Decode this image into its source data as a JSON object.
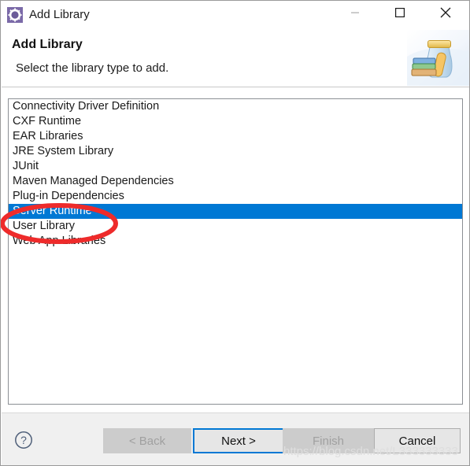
{
  "window": {
    "title": "Add Library",
    "icon": "library-wizard-icon",
    "controls": {
      "minimize": "minimize-icon",
      "maximize": "maximize-icon",
      "close": "close-icon"
    }
  },
  "header": {
    "title": "Add Library",
    "subtitle": "Select the library type to add.",
    "banner_icon": "books-jar-icon"
  },
  "list": {
    "items": [
      {
        "label": "Connectivity Driver Definition",
        "selected": false
      },
      {
        "label": "CXF Runtime",
        "selected": false
      },
      {
        "label": "EAR Libraries",
        "selected": false
      },
      {
        "label": "JRE System Library",
        "selected": false
      },
      {
        "label": "JUnit",
        "selected": false
      },
      {
        "label": "Maven Managed Dependencies",
        "selected": false
      },
      {
        "label": "Plug-in Dependencies",
        "selected": false
      },
      {
        "label": "Server Runtime",
        "selected": true
      },
      {
        "label": "User Library",
        "selected": false
      },
      {
        "label": "Web App Libraries",
        "selected": false
      }
    ],
    "selected_value": "Server Runtime"
  },
  "annotation": {
    "shape": "ellipse",
    "color": "#ee2b2b",
    "target": "Server Runtime"
  },
  "footer": {
    "help_icon": "help-question-icon",
    "buttons": {
      "back": "< Back",
      "next": "Next >",
      "finish": "Finish",
      "cancel": "Cancel"
    }
  },
  "watermark": {
    "text": "https://blog.csdn.net/L333333333"
  },
  "colors": {
    "selection": "#0078D4",
    "focus_border": "#0078D4",
    "annotation": "#EE2B2B",
    "footer_bg": "#F0F0F0",
    "button_disabled_bg": "#CCCCCC",
    "button_bg": "#E6E6E6"
  }
}
